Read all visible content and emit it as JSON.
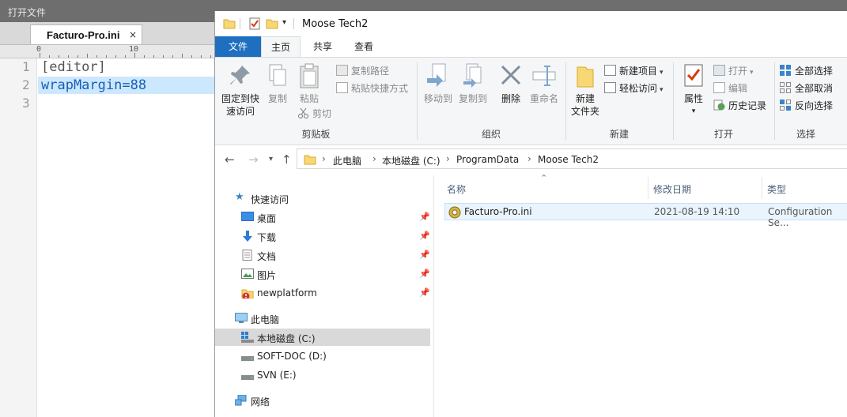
{
  "editor": {
    "window_title": "打开文件",
    "tab_label": "Facturo-Pro.ini",
    "tab_close": "×",
    "ruler_labels": [
      "0",
      "10"
    ],
    "lines": [
      {
        "number": "1",
        "text": "[editor]"
      },
      {
        "number": "2",
        "text": "wrapMargin=88"
      },
      {
        "number": "3",
        "text": ""
      }
    ]
  },
  "explorer": {
    "title": "Moose Tech2",
    "tabs": {
      "file": "文件",
      "home": "主页",
      "share": "共享",
      "view": "查看"
    },
    "ribbon": {
      "clipboard": {
        "label": "剪贴板",
        "pin_label_1": "固定到快",
        "pin_label_2": "速访问",
        "copy": "复制",
        "paste": "粘贴",
        "copy_path": "复制路径",
        "paste_shortcut": "粘贴快捷方式",
        "cut": "剪切"
      },
      "organize": {
        "label": "组织",
        "move_to": "移动到",
        "copy_to": "复制到",
        "delete": "删除",
        "rename": "重命名"
      },
      "new": {
        "label": "新建",
        "new_folder_1": "新建",
        "new_folder_2": "文件夹",
        "new_item": "新建项目",
        "easy_access": "轻松访问"
      },
      "open": {
        "label": "打开",
        "properties": "属性",
        "open": "打开",
        "edit": "编辑",
        "history": "历史记录"
      },
      "select": {
        "label": "选择",
        "select_all": "全部选择",
        "select_none": "全部取消",
        "invert": "反向选择"
      }
    },
    "breadcrumbs": [
      "此电脑",
      "本地磁盘 (C:)",
      "ProgramData",
      "Moose Tech2"
    ],
    "nav": {
      "quick_access": "快速访问",
      "pinned": [
        {
          "label": "桌面"
        },
        {
          "label": "下载"
        },
        {
          "label": "文档"
        },
        {
          "label": "图片"
        },
        {
          "label": "newplatform"
        }
      ],
      "this_pc": "此电脑",
      "drives": [
        {
          "label": "本地磁盘 (C:)"
        },
        {
          "label": "SOFT-DOC (D:)"
        },
        {
          "label": "SVN (E:)"
        }
      ],
      "network": "网络"
    },
    "columns": {
      "name": "名称",
      "modified": "修改日期",
      "type": "类型"
    },
    "files": [
      {
        "name": "Facturo-Pro.ini",
        "modified": "2021-08-19 14:10",
        "type": "Configuration Se..."
      }
    ]
  }
}
